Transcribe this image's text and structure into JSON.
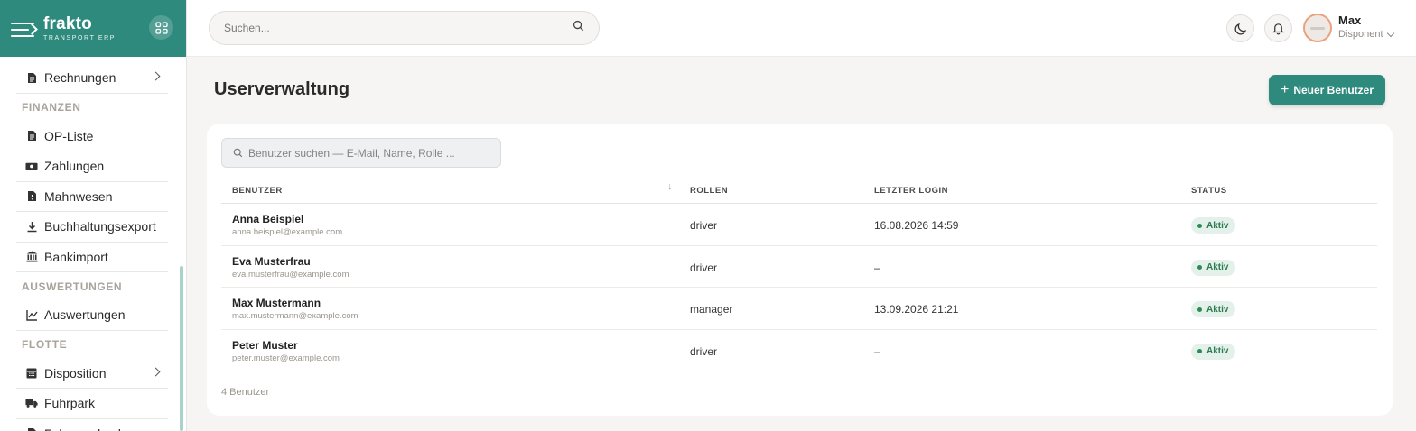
{
  "brand": {
    "name": "frakto",
    "tagline": "TRANSPORT ERP"
  },
  "sidebar": {
    "items": [
      {
        "type": "item",
        "label": "Rechnungen",
        "icon": "file-icon",
        "chevron": true
      },
      {
        "type": "section",
        "label": "FINANZEN"
      },
      {
        "type": "item",
        "label": "OP-Liste",
        "icon": "file-icon"
      },
      {
        "type": "item",
        "label": "Zahlungen",
        "icon": "money-icon"
      },
      {
        "type": "item",
        "label": "Mahnwesen",
        "icon": "file-warning-icon"
      },
      {
        "type": "item",
        "label": "Buchhaltungsexport",
        "icon": "download-icon"
      },
      {
        "type": "item",
        "label": "Bankimport",
        "icon": "bank-icon"
      },
      {
        "type": "section",
        "label": "AUSWERTUNGEN"
      },
      {
        "type": "item",
        "label": "Auswertungen",
        "icon": "chart-line-icon"
      },
      {
        "type": "section",
        "label": "FLOTTE"
      },
      {
        "type": "item",
        "label": "Disposition",
        "icon": "calendar-icon",
        "chevron": true
      },
      {
        "type": "item",
        "label": "Fuhrpark",
        "icon": "truck-icon"
      },
      {
        "type": "item",
        "label": "Fahrzeugbuch",
        "icon": "file-icon"
      }
    ]
  },
  "header": {
    "search_placeholder": "Suchen...",
    "user": {
      "name": "Max",
      "role": "Disponent"
    }
  },
  "main": {
    "title": "Userverwaltung",
    "new_user_label": "Neuer Benutzer",
    "user_search_placeholder": "Benutzer suchen — E-Mail, Name, Rolle ...",
    "table": {
      "columns": [
        "BENUTZER",
        "ROLLEN",
        "LETZTER LOGIN",
        "STATUS"
      ],
      "rows": [
        {
          "name": "Anna Beispiel",
          "email": "anna.beispiel@example.com",
          "role": "driver",
          "last_login": "16.08.2026 14:59",
          "status": "Aktiv"
        },
        {
          "name": "Eva Musterfrau",
          "email": "eva.musterfrau@example.com",
          "role": "driver",
          "last_login": "–",
          "status": "Aktiv"
        },
        {
          "name": "Max Mustermann",
          "email": "max.mustermann@example.com",
          "role": "manager",
          "last_login": "13.09.2026 21:21",
          "status": "Aktiv"
        },
        {
          "name": "Peter Muster",
          "email": "peter.muster@example.com",
          "role": "driver",
          "last_login": "–",
          "status": "Aktiv"
        }
      ],
      "footer": "4 Benutzer"
    }
  },
  "colors": {
    "brand": "#2f8a7e",
    "status_active": "#2c7a4f"
  }
}
